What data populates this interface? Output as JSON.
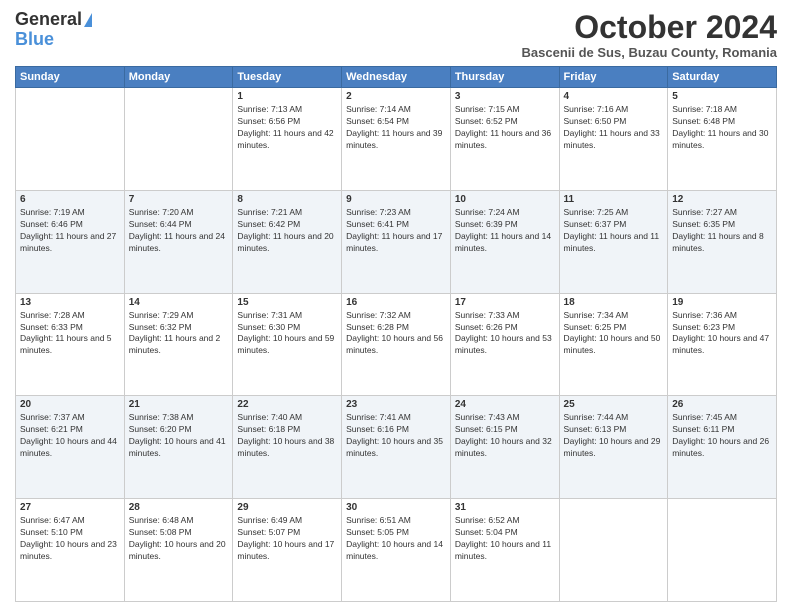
{
  "header": {
    "logo_line1": "General",
    "logo_line2": "Blue",
    "month_title": "October 2024",
    "subtitle": "Bascenii de Sus, Buzau County, Romania"
  },
  "days_of_week": [
    "Sunday",
    "Monday",
    "Tuesday",
    "Wednesday",
    "Thursday",
    "Friday",
    "Saturday"
  ],
  "weeks": [
    [
      {
        "day": "",
        "info": ""
      },
      {
        "day": "",
        "info": ""
      },
      {
        "day": "1",
        "info": "Sunrise: 7:13 AM\nSunset: 6:56 PM\nDaylight: 11 hours and 42 minutes."
      },
      {
        "day": "2",
        "info": "Sunrise: 7:14 AM\nSunset: 6:54 PM\nDaylight: 11 hours and 39 minutes."
      },
      {
        "day": "3",
        "info": "Sunrise: 7:15 AM\nSunset: 6:52 PM\nDaylight: 11 hours and 36 minutes."
      },
      {
        "day": "4",
        "info": "Sunrise: 7:16 AM\nSunset: 6:50 PM\nDaylight: 11 hours and 33 minutes."
      },
      {
        "day": "5",
        "info": "Sunrise: 7:18 AM\nSunset: 6:48 PM\nDaylight: 11 hours and 30 minutes."
      }
    ],
    [
      {
        "day": "6",
        "info": "Sunrise: 7:19 AM\nSunset: 6:46 PM\nDaylight: 11 hours and 27 minutes."
      },
      {
        "day": "7",
        "info": "Sunrise: 7:20 AM\nSunset: 6:44 PM\nDaylight: 11 hours and 24 minutes."
      },
      {
        "day": "8",
        "info": "Sunrise: 7:21 AM\nSunset: 6:42 PM\nDaylight: 11 hours and 20 minutes."
      },
      {
        "day": "9",
        "info": "Sunrise: 7:23 AM\nSunset: 6:41 PM\nDaylight: 11 hours and 17 minutes."
      },
      {
        "day": "10",
        "info": "Sunrise: 7:24 AM\nSunset: 6:39 PM\nDaylight: 11 hours and 14 minutes."
      },
      {
        "day": "11",
        "info": "Sunrise: 7:25 AM\nSunset: 6:37 PM\nDaylight: 11 hours and 11 minutes."
      },
      {
        "day": "12",
        "info": "Sunrise: 7:27 AM\nSunset: 6:35 PM\nDaylight: 11 hours and 8 minutes."
      }
    ],
    [
      {
        "day": "13",
        "info": "Sunrise: 7:28 AM\nSunset: 6:33 PM\nDaylight: 11 hours and 5 minutes."
      },
      {
        "day": "14",
        "info": "Sunrise: 7:29 AM\nSunset: 6:32 PM\nDaylight: 11 hours and 2 minutes."
      },
      {
        "day": "15",
        "info": "Sunrise: 7:31 AM\nSunset: 6:30 PM\nDaylight: 10 hours and 59 minutes."
      },
      {
        "day": "16",
        "info": "Sunrise: 7:32 AM\nSunset: 6:28 PM\nDaylight: 10 hours and 56 minutes."
      },
      {
        "day": "17",
        "info": "Sunrise: 7:33 AM\nSunset: 6:26 PM\nDaylight: 10 hours and 53 minutes."
      },
      {
        "day": "18",
        "info": "Sunrise: 7:34 AM\nSunset: 6:25 PM\nDaylight: 10 hours and 50 minutes."
      },
      {
        "day": "19",
        "info": "Sunrise: 7:36 AM\nSunset: 6:23 PM\nDaylight: 10 hours and 47 minutes."
      }
    ],
    [
      {
        "day": "20",
        "info": "Sunrise: 7:37 AM\nSunset: 6:21 PM\nDaylight: 10 hours and 44 minutes."
      },
      {
        "day": "21",
        "info": "Sunrise: 7:38 AM\nSunset: 6:20 PM\nDaylight: 10 hours and 41 minutes."
      },
      {
        "day": "22",
        "info": "Sunrise: 7:40 AM\nSunset: 6:18 PM\nDaylight: 10 hours and 38 minutes."
      },
      {
        "day": "23",
        "info": "Sunrise: 7:41 AM\nSunset: 6:16 PM\nDaylight: 10 hours and 35 minutes."
      },
      {
        "day": "24",
        "info": "Sunrise: 7:43 AM\nSunset: 6:15 PM\nDaylight: 10 hours and 32 minutes."
      },
      {
        "day": "25",
        "info": "Sunrise: 7:44 AM\nSunset: 6:13 PM\nDaylight: 10 hours and 29 minutes."
      },
      {
        "day": "26",
        "info": "Sunrise: 7:45 AM\nSunset: 6:11 PM\nDaylight: 10 hours and 26 minutes."
      }
    ],
    [
      {
        "day": "27",
        "info": "Sunrise: 6:47 AM\nSunset: 5:10 PM\nDaylight: 10 hours and 23 minutes."
      },
      {
        "day": "28",
        "info": "Sunrise: 6:48 AM\nSunset: 5:08 PM\nDaylight: 10 hours and 20 minutes."
      },
      {
        "day": "29",
        "info": "Sunrise: 6:49 AM\nSunset: 5:07 PM\nDaylight: 10 hours and 17 minutes."
      },
      {
        "day": "30",
        "info": "Sunrise: 6:51 AM\nSunset: 5:05 PM\nDaylight: 10 hours and 14 minutes."
      },
      {
        "day": "31",
        "info": "Sunrise: 6:52 AM\nSunset: 5:04 PM\nDaylight: 10 hours and 11 minutes."
      },
      {
        "day": "",
        "info": ""
      },
      {
        "day": "",
        "info": ""
      }
    ]
  ]
}
